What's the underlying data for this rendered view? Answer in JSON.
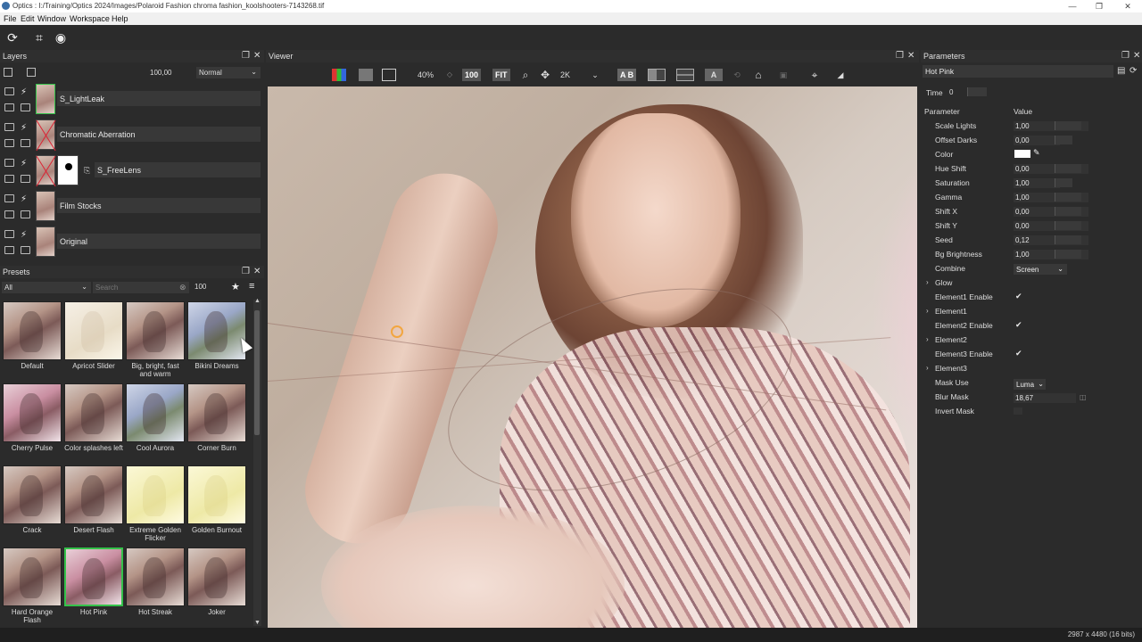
{
  "window": {
    "title": "Optics : I:/Training/Optics 2024/Images/Polaroid Fashion chroma fashion_koolshooters-7143268.tif",
    "minimize": "—",
    "restore": "❐",
    "close": "✕"
  },
  "menu": [
    "File",
    "Edit",
    "Window",
    "Workspace",
    "Help"
  ],
  "layers": {
    "title": "Layers",
    "opacity": "100,00",
    "blend_mode": "Normal",
    "items": [
      {
        "name": "S_LightLeak"
      },
      {
        "name": "Chromatic Aberration"
      },
      {
        "name": "S_FreeLens"
      },
      {
        "name": "Film Stocks"
      },
      {
        "name": "Original"
      }
    ]
  },
  "presets": {
    "title": "Presets",
    "category": "All",
    "search_placeholder": "Search",
    "size": "100",
    "items": [
      {
        "name": "Default"
      },
      {
        "name": "Apricot Slider"
      },
      {
        "name": "Big, bright, fast and warm"
      },
      {
        "name": "Bikini Dreams"
      },
      {
        "name": "Cherry Pulse"
      },
      {
        "name": "Color splashes left"
      },
      {
        "name": "Cool Aurora"
      },
      {
        "name": "Corner Burn"
      },
      {
        "name": "Crack"
      },
      {
        "name": "Desert Flash"
      },
      {
        "name": "Extreme Golden Flicker"
      },
      {
        "name": "Golden Burnout"
      },
      {
        "name": "Hard Orange Flash"
      },
      {
        "name": "Hot Pink"
      },
      {
        "name": "Hot Streak"
      },
      {
        "name": "Joker"
      }
    ]
  },
  "viewer": {
    "title": "Viewer",
    "zoom": "40%",
    "btn_100": "100",
    "btn_fit": "FIT",
    "resolution": "2K",
    "ab": "A B"
  },
  "parameters": {
    "title": "Parameters",
    "preset_name": "Hot Pink",
    "time_label": "Time",
    "time_value": "0",
    "col_param": "Parameter",
    "col_value": "Value",
    "rows": [
      {
        "label": "Scale Lights",
        "value": "1,00"
      },
      {
        "label": "Offset Darks",
        "value": "0,00"
      },
      {
        "label": "Color",
        "value": ""
      },
      {
        "label": "Hue Shift",
        "value": "0,00"
      },
      {
        "label": "Saturation",
        "value": "1,00"
      },
      {
        "label": "Gamma",
        "value": "1,00"
      },
      {
        "label": "Shift X",
        "value": "0,00"
      },
      {
        "label": "Shift Y",
        "value": "0,00"
      },
      {
        "label": "Seed",
        "value": "0,12"
      },
      {
        "label": "Bg Brightness",
        "value": "1,00"
      }
    ],
    "combine_label": "Combine",
    "combine_value": "Screen",
    "glow": "Glow",
    "element1_enable": "Element1 Enable",
    "element1": "Element1",
    "element2_enable": "Element2 Enable",
    "element2": "Element2",
    "element3_enable": "Element3 Enable",
    "element3": "Element3",
    "mask_use_label": "Mask Use",
    "mask_use_value": "Luma",
    "blur_mask_label": "Blur Mask",
    "blur_mask_value": "18,67",
    "invert_mask_label": "Invert Mask",
    "check": "✔"
  },
  "status": {
    "info": "2987 x 4480 (16 bits)"
  },
  "colors": {
    "accent_green": "#34c24a",
    "swatch": "#ffffff"
  }
}
